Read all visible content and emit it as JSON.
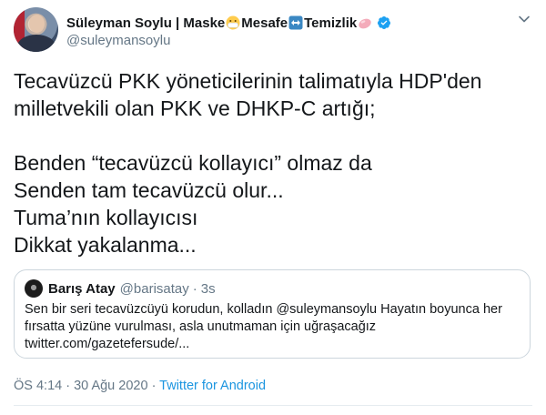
{
  "author": {
    "name": "Süleyman Soylu | Maske",
    "name_part2": " Mesafe",
    "name_part3": " Temizlik",
    "handle": "@suleymansoylu",
    "icons": [
      "mask-emoji-icon",
      "left-right-arrow-emoji-icon",
      "soap-emoji-icon",
      "verified-badge-icon"
    ]
  },
  "tweet": {
    "lines": [
      "Tecavüzcü PKK yöneticilerinin talimatıyla HDP'den",
      "milletvekili olan PKK ve DHKP-C artığı;",
      "",
      "Benden “tecavüzcü kollayıcı” olmaz da",
      "Senden tam tecavüzcü olur...",
      "Tuma’nın kollayıcısı",
      "Dikkat yakalanma..."
    ]
  },
  "quoted": {
    "name": "Barış Atay",
    "handle": "@barisatay",
    "separator": "·",
    "time": "3s",
    "lines": [
      "Sen bir seri tecavüzcüyü korudun, kolladın @suleymansoylu Hayatın boyunca her",
      "fırsatta yüzüne vurulması, asla unutmaman için uğraşacağız",
      "twitter.com/gazetefersude/..."
    ]
  },
  "meta": {
    "time": "ÖS 4:14",
    "separator": " · ",
    "date": "30 Ağu 2020",
    "source": "Twitter for Android"
  },
  "colors": {
    "verified": "#1da1f2",
    "link": "#1b95e0",
    "secondary": "#657786"
  }
}
